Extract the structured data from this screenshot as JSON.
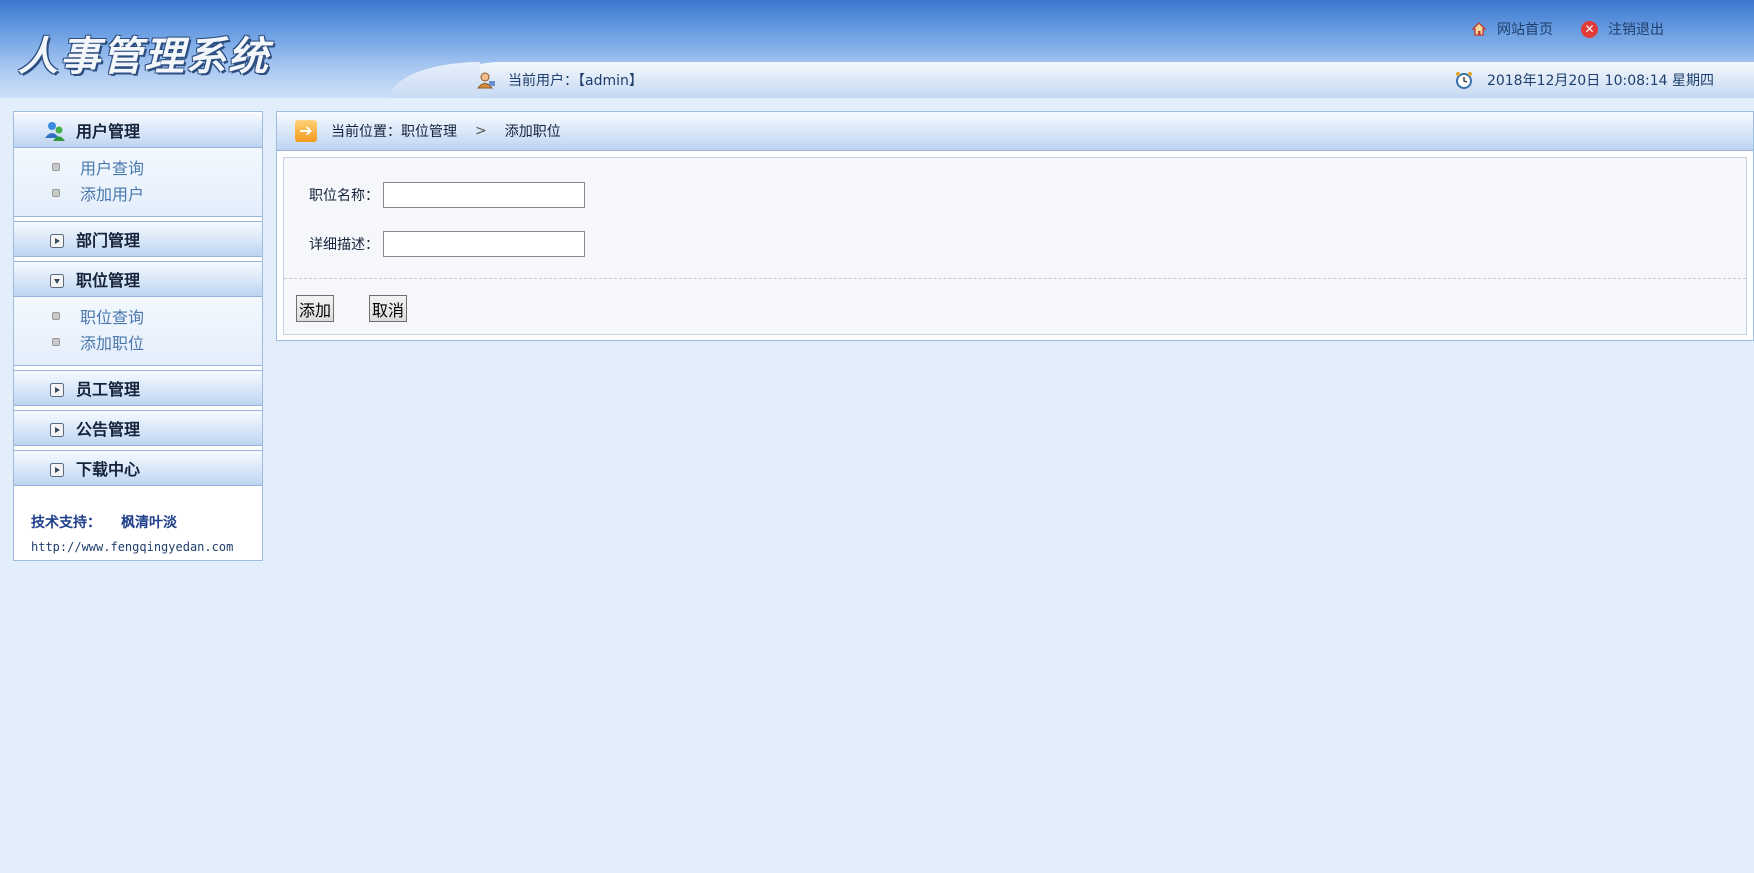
{
  "header": {
    "app_title": "人事管理系统",
    "home_link": "网站首页",
    "logout_link": "注销退出",
    "current_user_label": "当前用户：【admin】",
    "datetime": "2018年12月20日 10:08:14 星期四"
  },
  "sidebar": {
    "menus": [
      {
        "label": "用户管理",
        "items": [
          "用户查询",
          "添加用户"
        ]
      },
      {
        "label": "部门管理"
      },
      {
        "label": "职位管理",
        "items": [
          "职位查询",
          "添加职位"
        ]
      },
      {
        "label": "员工管理"
      },
      {
        "label": "公告管理"
      },
      {
        "label": "下载中心"
      }
    ],
    "support_label": "技术支持：",
    "support_name": "枫清叶淡",
    "support_url": "http://www.fengqingyedan.com"
  },
  "main": {
    "breadcrumb_prefix": "当前位置：职位管理",
    "breadcrumb_sep": ">",
    "breadcrumb_current": "添加职位",
    "form": {
      "name_label": "职位名称：",
      "name_value": "",
      "desc_label": "详细描述：",
      "desc_value": ""
    },
    "add_button": "添加",
    "cancel_button": "取消"
  }
}
